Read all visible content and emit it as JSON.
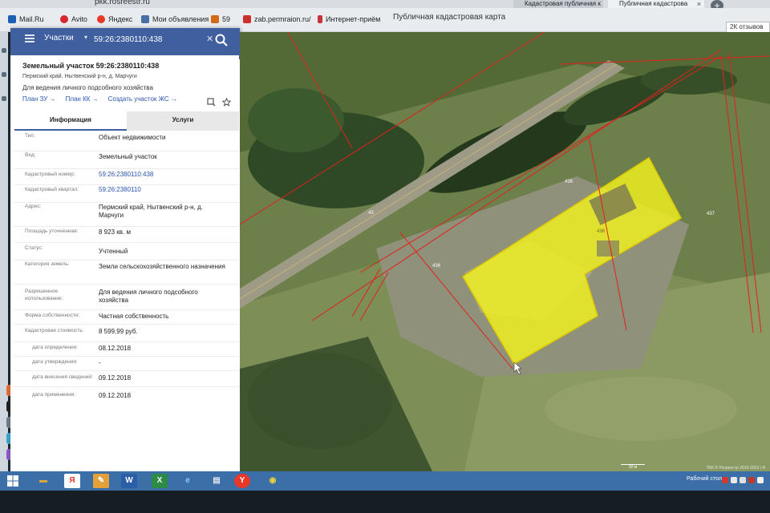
{
  "browser": {
    "url": "pkk.rosreestr.ru",
    "page_title": "Публичная кадастровая карта",
    "tabs": [
      {
        "label": "Кадастровая публичная к"
      },
      {
        "label": "Публичная кадастрова"
      }
    ],
    "bookmarks": [
      {
        "label": "Mail.Ru",
        "color": "#1b5fb5"
      },
      {
        "label": "Avito",
        "color": "#d8262f"
      },
      {
        "label": "Яндекс",
        "color": "#e8382a"
      },
      {
        "label": "Мои объявления",
        "color": "#4a6fa5"
      },
      {
        "label": "59",
        "color": "#d36a16"
      },
      {
        "label": "zab.permraion.ru/",
        "color": "#cc2f2f"
      },
      {
        "label": "Интернет-приём",
        "color": "#c8343a"
      }
    ],
    "feedback_label": "2К отзывов"
  },
  "search": {
    "type": "Участки",
    "value": "59:26:2380110:438"
  },
  "object": {
    "title": "Земельный участок 59:26:2380110:438",
    "address_short": "Пермский край, Нытвенский р-н, д. Марчуги",
    "use": "Для ведения личного подсобного хозяйства",
    "links": [
      "План ЗУ →",
      "План КК →",
      "Создать участок ЖС →"
    ]
  },
  "tabs": {
    "info": "Информация",
    "services": "Услуги"
  },
  "fields": [
    {
      "k": "Тип:",
      "v": "Объект недвижимости"
    },
    {
      "k": "Вид:",
      "v": "Земельный участок"
    },
    {
      "k": "Кадастровый номер:",
      "v": "59:26:2380110:438",
      "link": true
    },
    {
      "k": "Кадастровый квартал:",
      "v": "59:26:2380110",
      "link": true
    },
    {
      "k": "Адрес:",
      "v": "Пермский край, Нытвенский р-н, д. Марчуги"
    },
    {
      "k": "Площадь уточненная:",
      "v": "8 923 кв. м"
    },
    {
      "k": "Статус:",
      "v": "Учтенный"
    },
    {
      "k": "Категория земель:",
      "v": "Земли сельскохозяйственного назначения"
    },
    {
      "k": "Разрешенное использование:",
      "v": "Для ведения личного подсобного хозяйства"
    },
    {
      "k": "Форма собственности:",
      "v": "Частная собственность"
    },
    {
      "k": "Кадастровая стоимость:",
      "v": "8 599,99 руб."
    },
    {
      "k": "дата определения:",
      "v": "08.12.2018"
    },
    {
      "k": "дата утверждения:",
      "v": "-"
    },
    {
      "k": "дата внесения сведений:",
      "v": "09.12.2018"
    },
    {
      "k": "дата применения:",
      "v": "09.12.2018"
    }
  ],
  "map": {
    "parcel_labels": [
      "436",
      "437",
      "438",
      "43",
      "436"
    ],
    "footer": "ПКК © Росреестр 2010-2023 | Ф",
    "scale": "30 м",
    "highlight_color": "#f2f21e"
  },
  "taskbar": {
    "desktop_label": "Рабочий стол",
    "apps": [
      {
        "icon": "folder-icon",
        "glyph": "▬",
        "color": "#d9a441"
      },
      {
        "icon": "yandex-icon",
        "glyph": "Я",
        "color": "#ffffff"
      },
      {
        "icon": "notes-icon",
        "glyph": "✎",
        "color": "#e4a13a"
      },
      {
        "icon": "word-icon",
        "glyph": "W",
        "color": "#2a5fa8"
      },
      {
        "icon": "excel-icon",
        "glyph": "X",
        "color": "#2e8b45"
      },
      {
        "icon": "ie-icon",
        "glyph": "e",
        "color": "#1e8fd6"
      },
      {
        "icon": "doc-icon",
        "glyph": "▤",
        "color": "#dfe4ea"
      },
      {
        "icon": "yandex-browser-icon",
        "glyph": "Y",
        "color": "#e8382a"
      },
      {
        "icon": "chrome-icon",
        "glyph": "◉",
        "color": "#e8d33f"
      }
    ]
  }
}
